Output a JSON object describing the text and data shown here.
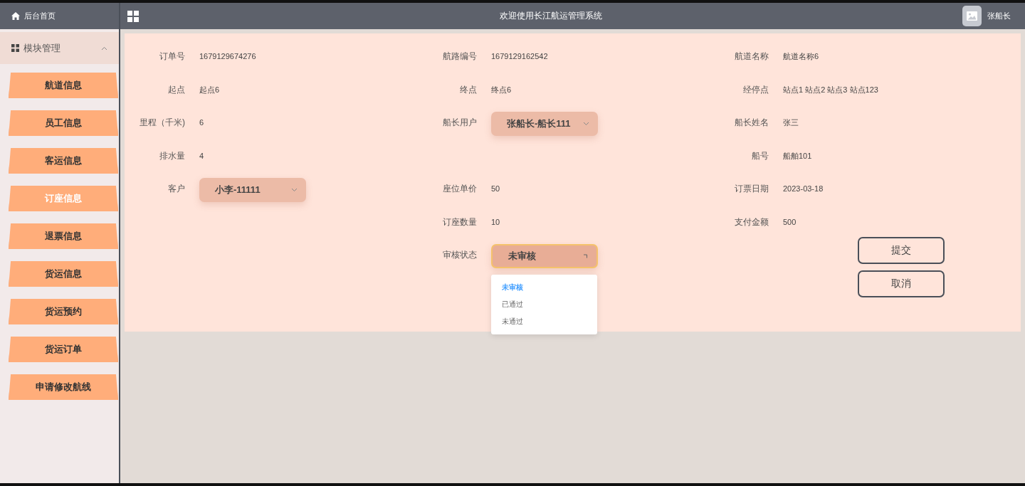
{
  "sidebar": {
    "home": "后台首页",
    "group": {
      "title": "模块管理",
      "expanded": true,
      "items": [
        {
          "label": "航道信息",
          "selected": false
        },
        {
          "label": "员工信息",
          "selected": false
        },
        {
          "label": "客运信息",
          "selected": false
        },
        {
          "label": "订座信息",
          "selected": true
        },
        {
          "label": "退票信息",
          "selected": false
        },
        {
          "label": "货运信息",
          "selected": false
        },
        {
          "label": "货运预约",
          "selected": false
        },
        {
          "label": "货运订单",
          "selected": false
        },
        {
          "label": "申请修改航线",
          "selected": false
        }
      ]
    }
  },
  "topbar": {
    "title": "欢迎使用长江航运管理系统",
    "user": "张船长"
  },
  "form": {
    "columns": [
      [
        {
          "kind": "text",
          "label": "订单号",
          "value": "1679129674276"
        },
        {
          "kind": "text",
          "label": "起点",
          "value": "起点6"
        },
        {
          "kind": "text",
          "label": "里程（千米)",
          "value": "6"
        },
        {
          "kind": "text",
          "label": "排水量",
          "value": "4"
        },
        {
          "kind": "select",
          "label": "客户",
          "value": "小李-11111",
          "open": false
        }
      ],
      [
        {
          "kind": "text",
          "label": "航路编号",
          "value": "1679129162542"
        },
        {
          "kind": "text",
          "label": "终点",
          "value": "终点6"
        },
        {
          "kind": "select",
          "label": "船长用户",
          "value": "张船长-船长111",
          "open": false
        },
        {
          "kind": "text",
          "label": "座位单价",
          "value": "50"
        },
        {
          "kind": "text",
          "label": "订座数量",
          "value": "10"
        },
        {
          "kind": "select",
          "label": "审核状态",
          "value": "未审核",
          "open": true,
          "options": [
            {
              "label": "未审核",
              "selected": true
            },
            {
              "label": "已通过",
              "selected": false
            },
            {
              "label": "未通过",
              "selected": false
            }
          ]
        }
      ],
      [
        {
          "kind": "text",
          "label": "航道名称",
          "value": "航道名称6"
        },
        {
          "kind": "text",
          "label": "经停点",
          "value": "站点1 站点2 站点3 站点123"
        },
        {
          "kind": "text",
          "label": "船长姓名",
          "value": "张三"
        },
        {
          "kind": "text",
          "label": "船号",
          "value": "船舶101"
        },
        {
          "kind": "text",
          "label": "订票日期",
          "value": "2023-03-18"
        },
        {
          "kind": "text",
          "label": "支付金额",
          "value": "500"
        }
      ]
    ],
    "buttons": [
      {
        "label": "提交"
      },
      {
        "label": "取消"
      }
    ]
  }
}
